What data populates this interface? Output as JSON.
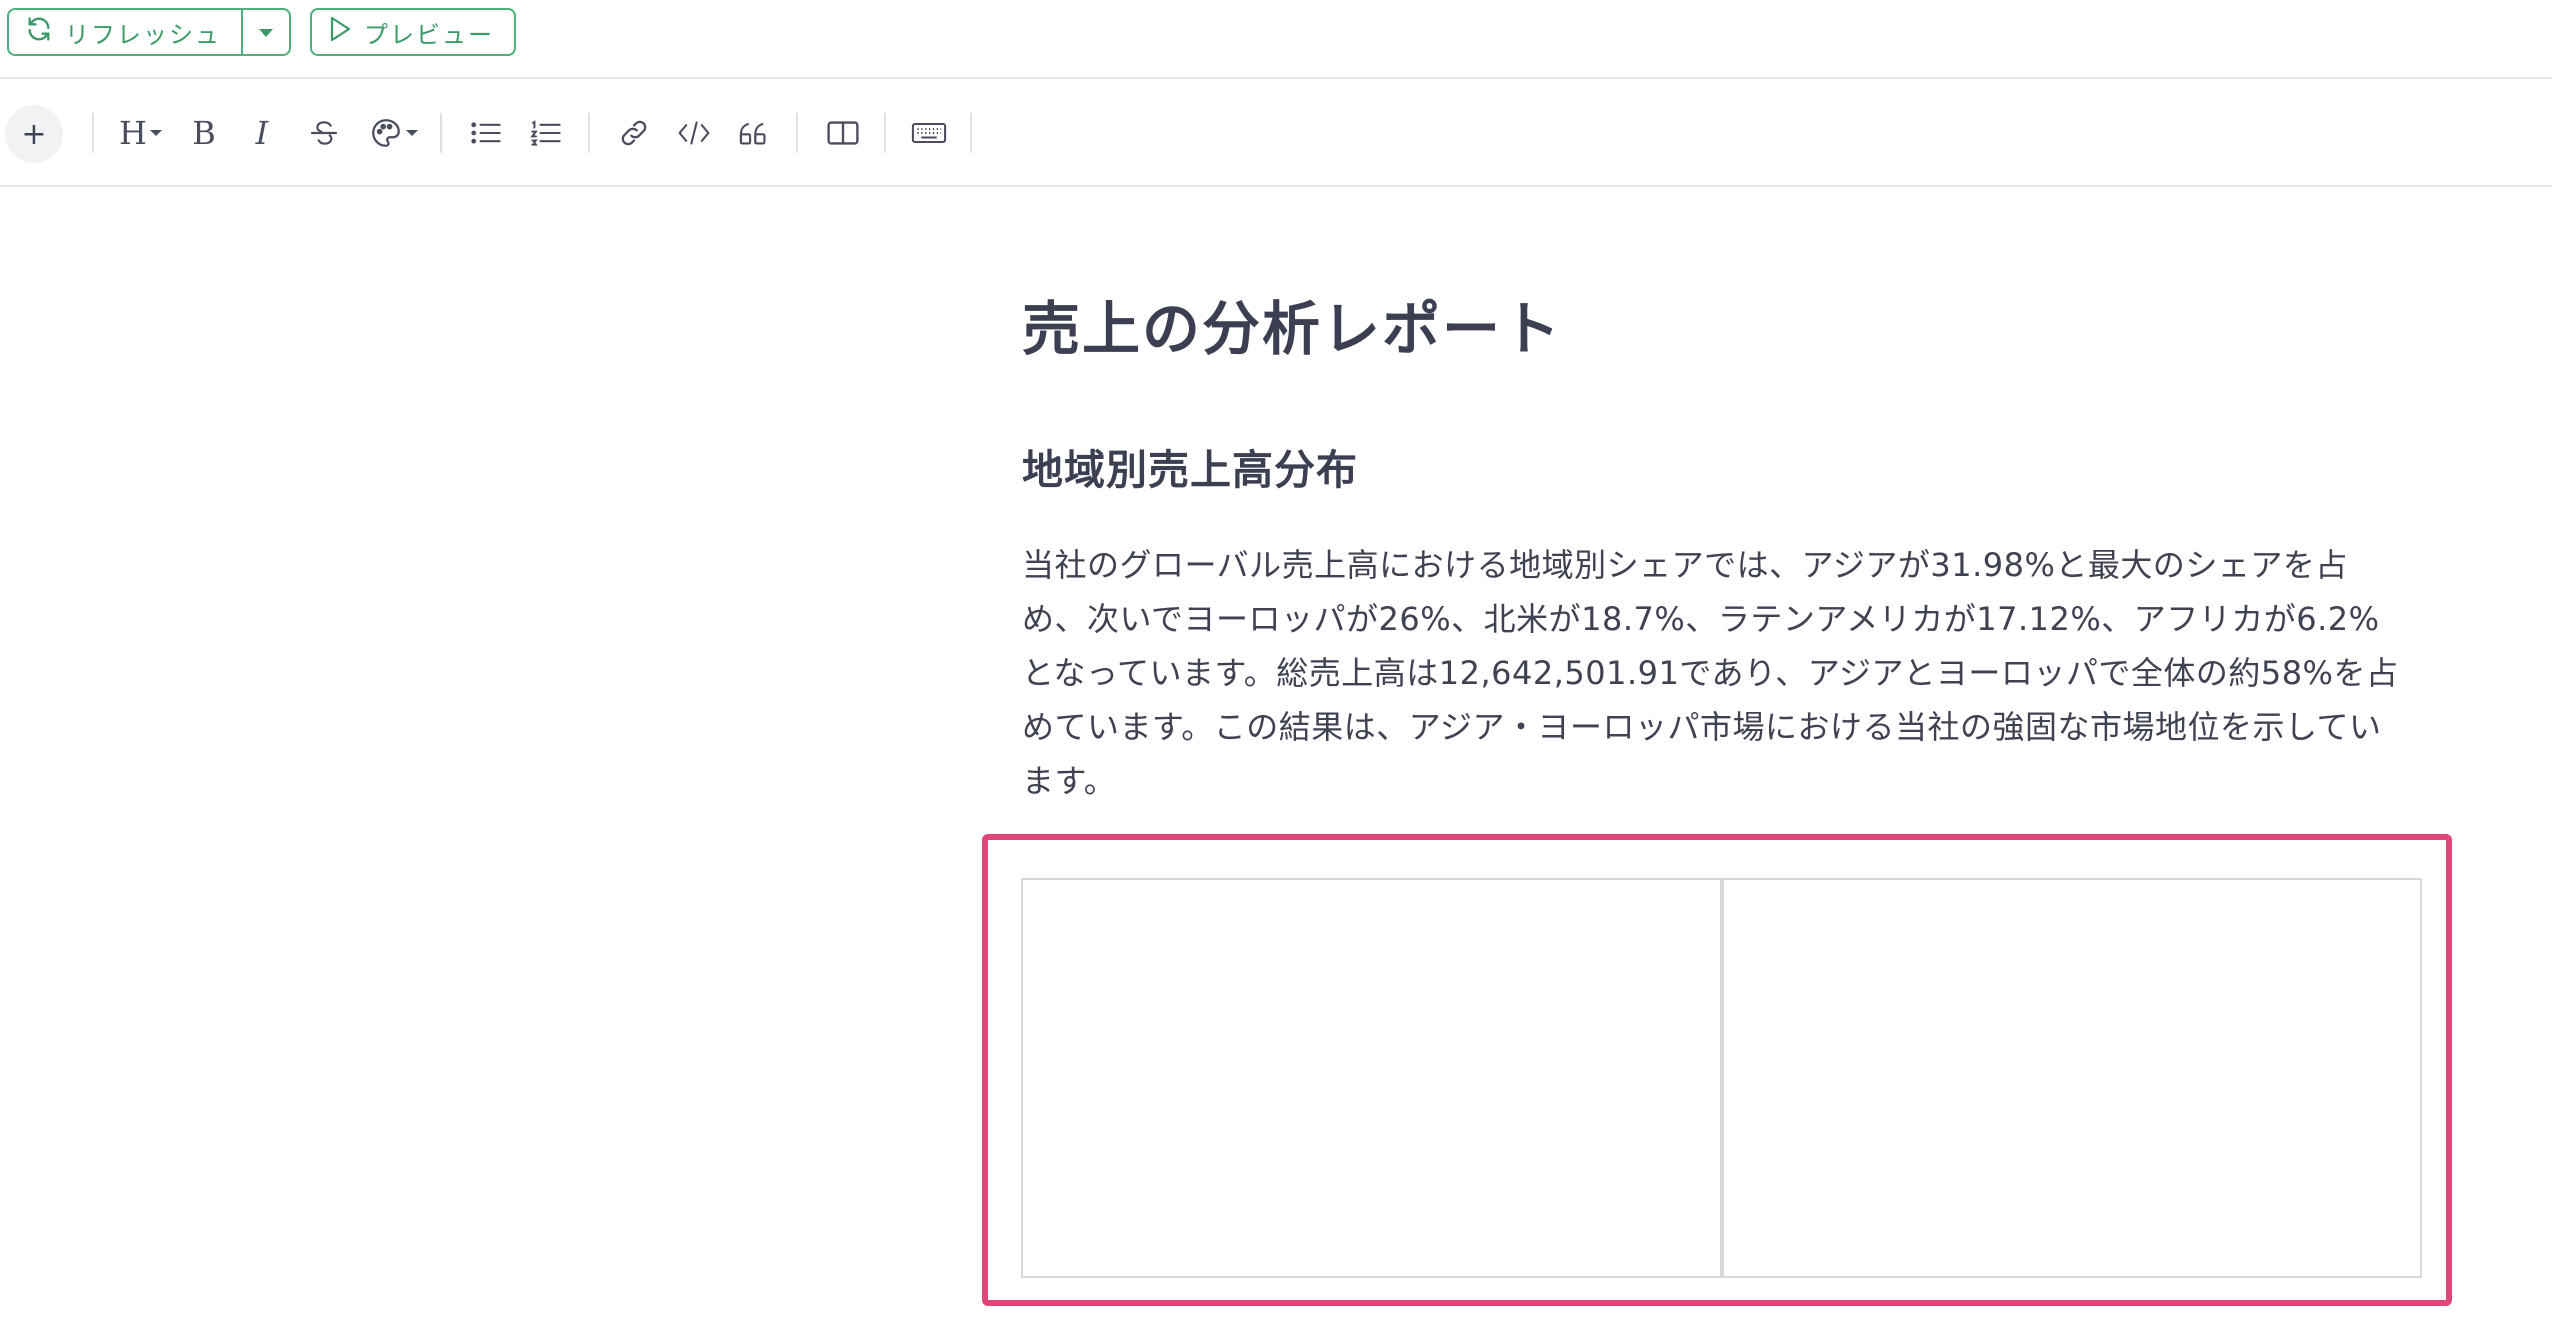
{
  "topbar": {
    "refresh_label": "リフレッシュ",
    "preview_label": "プレビュー",
    "accent_color": "#4fae7c"
  },
  "toolbar": {
    "icons": [
      "plus-icon",
      "heading-icon",
      "bold-icon",
      "italic-icon",
      "strikethrough-icon",
      "palette-icon",
      "bullet-list-icon",
      "numbered-list-icon",
      "link-icon",
      "code-icon",
      "quote-icon",
      "columns-icon",
      "keyboard-icon"
    ],
    "plus_label": "+",
    "heading_label": "H",
    "bold_label": "B",
    "italic_label": "I"
  },
  "document": {
    "title": "売上の分析レポート",
    "heading": "地域別売上高分布",
    "paragraph": "当社のグローバル売上高における地域別シェアでは、アジアが31.98%と最大のシェアを占め、次いでヨーロッパが26%、北米が18.7%、ラテンアメリカが17.12%、アフリカが6.2%となっています。総売上高は12,642,501.91であり、アジアとヨーロッパで全体の約58%を占めています。この結果は、アジア・ヨーロッパ市場における当社の強固な市場地位を示しています。",
    "highlight_color": "#e0467a"
  }
}
